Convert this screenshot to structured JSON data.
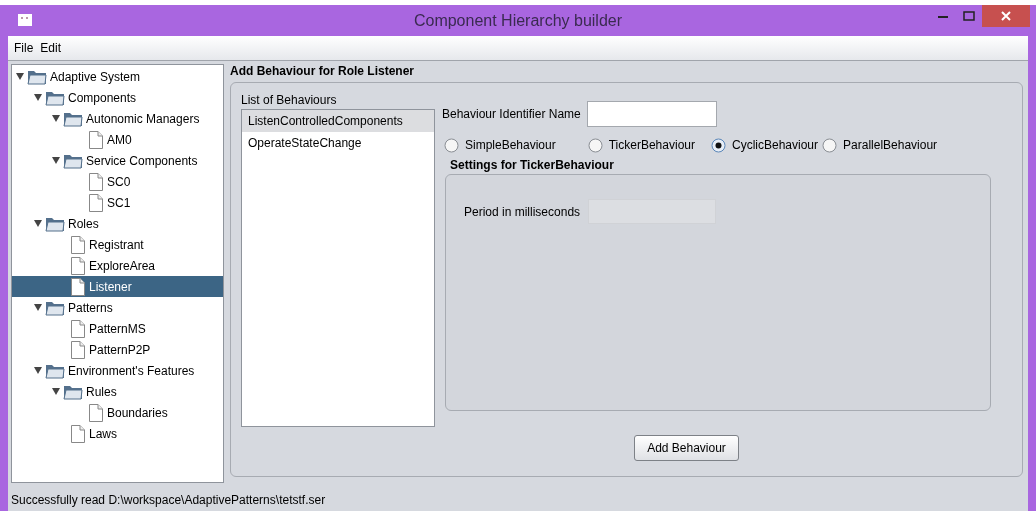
{
  "window": {
    "title": "Component Hierarchy builder"
  },
  "menu": [
    {
      "label": "File"
    },
    {
      "label": "Edit"
    }
  ],
  "tree": [
    {
      "label": "Adaptive System",
      "kind": "folder",
      "expanded": true,
      "selected": false,
      "children": [
        {
          "label": "Components",
          "kind": "folder",
          "expanded": true,
          "selected": false,
          "children": [
            {
              "label": "Autonomic Managers",
              "kind": "folder",
              "expanded": true,
              "selected": false,
              "children": [
                {
                  "label": "AM0",
                  "kind": "file",
                  "selected": false
                }
              ]
            },
            {
              "label": "Service Components",
              "kind": "folder",
              "expanded": true,
              "selected": false,
              "children": [
                {
                  "label": "SC0",
                  "kind": "file",
                  "selected": false
                },
                {
                  "label": "SC1",
                  "kind": "file",
                  "selected": false
                }
              ]
            }
          ]
        },
        {
          "label": "Roles",
          "kind": "folder",
          "expanded": true,
          "selected": false,
          "children": [
            {
              "label": "Registrant",
              "kind": "file",
              "selected": false
            },
            {
              "label": "ExploreArea",
              "kind": "file",
              "selected": false
            },
            {
              "label": "Listener",
              "kind": "file",
              "selected": true
            }
          ]
        },
        {
          "label": "Patterns",
          "kind": "folder",
          "expanded": true,
          "selected": false,
          "children": [
            {
              "label": "PatternMS",
              "kind": "file",
              "selected": false
            },
            {
              "label": "PatternP2P",
              "kind": "file",
              "selected": false
            }
          ]
        },
        {
          "label": "Environment's Features",
          "kind": "folder",
          "expanded": true,
          "selected": false,
          "children": [
            {
              "label": "Rules",
              "kind": "folder",
              "expanded": true,
              "selected": false,
              "children": [
                {
                  "label": "Boundaries",
                  "kind": "file",
                  "selected": false
                }
              ]
            },
            {
              "label": "Laws",
              "kind": "file",
              "selected": false
            }
          ]
        }
      ]
    }
  ],
  "panel": {
    "title": "Add Behaviour for Role Listener",
    "list_label": "List of Behaviours",
    "behaviours": [
      {
        "label": "ListenControlledComponents",
        "selected": true
      },
      {
        "label": "OperateStateChange",
        "selected": false
      }
    ],
    "identifier_label": "Behaviour Identifier Name",
    "types": [
      {
        "label": "SimpleBehaviour",
        "selected": false
      },
      {
        "label": "TickerBehaviour",
        "selected": false
      },
      {
        "label": "CyclicBehaviour",
        "selected": true
      },
      {
        "label": "ParallelBehaviour",
        "selected": false
      }
    ],
    "settings_title": "Settings for TickerBehaviour",
    "period_label": "Period in milliseconds",
    "period_disabled": true,
    "button": "Add Behaviour"
  },
  "status_bar": "Successfully read D:\\workspace\\AdaptivePatterns\\tetstf.ser"
}
